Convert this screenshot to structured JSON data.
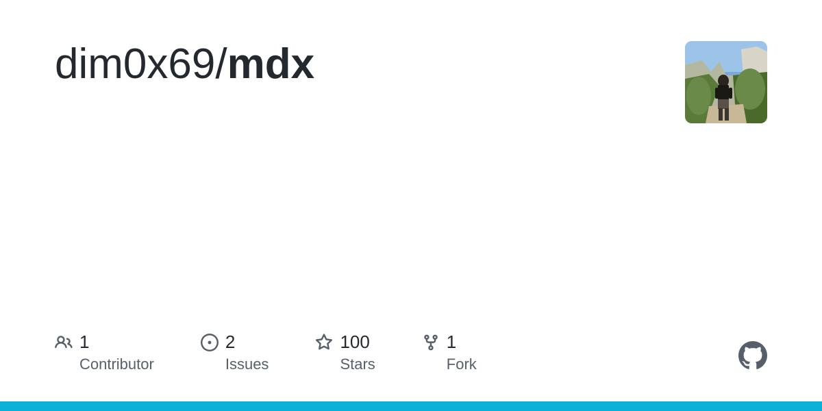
{
  "header": {
    "owner": "dim0x69",
    "separator": "/",
    "repo": "mdx"
  },
  "stats": {
    "contributors": {
      "count": "1",
      "label": "Contributor"
    },
    "issues": {
      "count": "2",
      "label": "Issues"
    },
    "stars": {
      "count": "100",
      "label": "Stars"
    },
    "forks": {
      "count": "1",
      "label": "Fork"
    }
  },
  "colors": {
    "accent": "#0ab0d6",
    "text_primary": "#24292f",
    "text_muted": "#57606a"
  }
}
